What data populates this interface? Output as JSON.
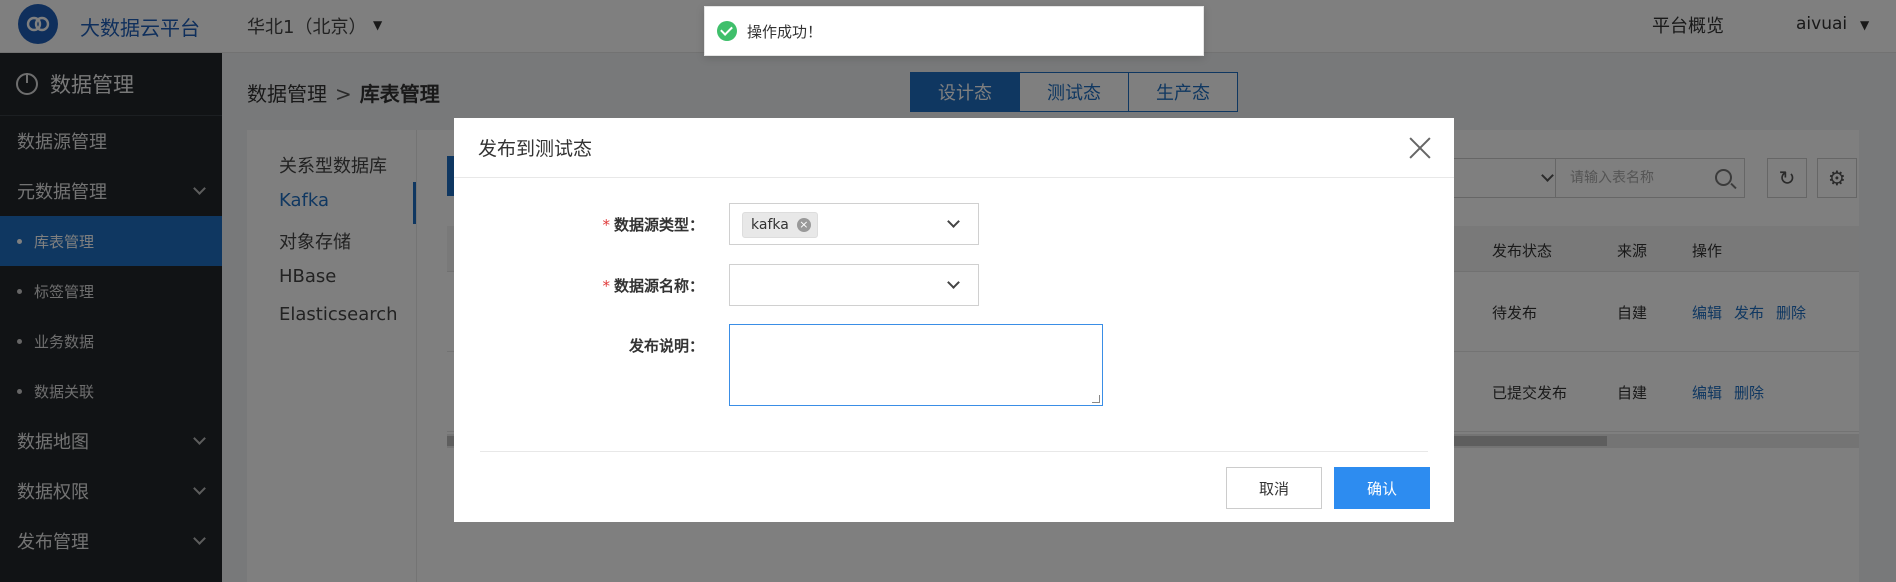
{
  "topbar": {
    "brand": "大数据云平台",
    "region": "华北1（北京）",
    "overview": "平台概览",
    "user": "aivuai"
  },
  "sidebar": {
    "title": "数据管理",
    "items": [
      {
        "label": "数据源管理"
      },
      {
        "label": "元数据管理"
      },
      {
        "label": "库表管理"
      },
      {
        "label": "标签管理"
      },
      {
        "label": "业务数据"
      },
      {
        "label": "数据关联"
      },
      {
        "label": "数据地图"
      },
      {
        "label": "数据权限"
      },
      {
        "label": "发布管理"
      }
    ]
  },
  "breadcrumb": {
    "parent": "数据管理",
    "separator": ">",
    "current": "库表管理"
  },
  "env_tabs": [
    "设计态",
    "测试态",
    "生产态"
  ],
  "db_types": [
    "关系型数据库",
    "Kafka",
    "对象存储",
    "HBase",
    "Elasticsearch"
  ],
  "search": {
    "placeholder": "请输入表名称"
  },
  "table": {
    "headers": [
      "发布状态",
      "来源",
      "操作"
    ],
    "rows": [
      {
        "status": "待发布",
        "source": "自建",
        "actions": [
          "编辑",
          "发布",
          "删除"
        ]
      },
      {
        "status": "已提交发布",
        "source": "自建",
        "actions": [
          "编辑",
          "删除"
        ]
      }
    ]
  },
  "toast": {
    "message": "操作成功！"
  },
  "modal": {
    "title": "发布到测试态",
    "fields": {
      "type_label": "数据源类型：",
      "type_value": "kafka",
      "name_label": "数据源名称：",
      "desc_label": "发布说明："
    },
    "cancel": "取消",
    "confirm": "确认"
  }
}
